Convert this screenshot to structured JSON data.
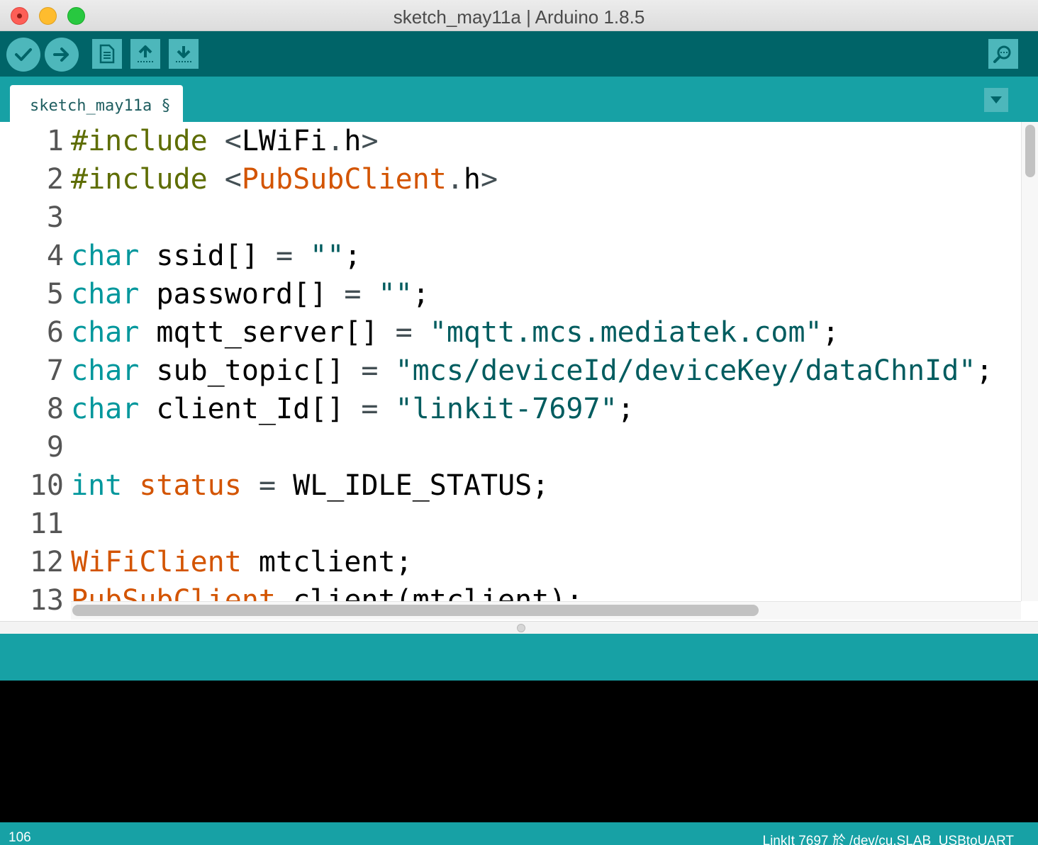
{
  "window": {
    "title": "sketch_may11a | Arduino 1.8.5"
  },
  "toolbar": {
    "verify": "check-icon",
    "upload": "arrow-right-icon",
    "new": "new-file-icon",
    "open": "arrow-up-icon",
    "save": "arrow-down-icon",
    "serial_monitor": "magnifier-icon"
  },
  "tabs": [
    {
      "label": "sketch_may11a §"
    }
  ],
  "editor": {
    "line_numbers": [
      "1",
      "2",
      "3",
      "4",
      "5",
      "6",
      "7",
      "8",
      "9",
      "10",
      "11",
      "12",
      "13"
    ],
    "lines": [
      [
        {
          "t": "#include",
          "c": "kw-pre"
        },
        {
          "t": " "
        },
        {
          "t": "<",
          "c": "kw-op"
        },
        {
          "t": "LWiFi"
        },
        {
          "t": ".",
          "c": "kw-op"
        },
        {
          "t": "h"
        },
        {
          "t": ">",
          "c": "kw-op"
        }
      ],
      [
        {
          "t": "#include",
          "c": "kw-pre"
        },
        {
          "t": " "
        },
        {
          "t": "<",
          "c": "kw-op"
        },
        {
          "t": "PubSubClient",
          "c": "kw-lib"
        },
        {
          "t": ".",
          "c": "kw-op"
        },
        {
          "t": "h"
        },
        {
          "t": ">",
          "c": "kw-op"
        }
      ],
      [],
      [
        {
          "t": "char",
          "c": "kw-type"
        },
        {
          "t": " ssid[] "
        },
        {
          "t": "=",
          "c": "kw-op"
        },
        {
          "t": " "
        },
        {
          "t": "\"\"",
          "c": "kw-str"
        },
        {
          "t": ";"
        }
      ],
      [
        {
          "t": "char",
          "c": "kw-type"
        },
        {
          "t": " password[] "
        },
        {
          "t": "=",
          "c": "kw-op"
        },
        {
          "t": " "
        },
        {
          "t": "\"\"",
          "c": "kw-str"
        },
        {
          "t": ";"
        }
      ],
      [
        {
          "t": "char",
          "c": "kw-type"
        },
        {
          "t": " mqtt_server[] "
        },
        {
          "t": "=",
          "c": "kw-op"
        },
        {
          "t": " "
        },
        {
          "t": "\"mqtt.mcs.mediatek.com\"",
          "c": "kw-str"
        },
        {
          "t": ";"
        }
      ],
      [
        {
          "t": "char",
          "c": "kw-type"
        },
        {
          "t": " sub_topic[] "
        },
        {
          "t": "=",
          "c": "kw-op"
        },
        {
          "t": " "
        },
        {
          "t": "\"mcs/deviceId/deviceKey/dataChnId\"",
          "c": "kw-str"
        },
        {
          "t": ";"
        }
      ],
      [
        {
          "t": "char",
          "c": "kw-type"
        },
        {
          "t": " client_Id[] "
        },
        {
          "t": "=",
          "c": "kw-op"
        },
        {
          "t": " "
        },
        {
          "t": "\"linkit-7697\"",
          "c": "kw-str"
        },
        {
          "t": ";"
        }
      ],
      [],
      [
        {
          "t": "int",
          "c": "kw-type"
        },
        {
          "t": " "
        },
        {
          "t": "status",
          "c": "kw-lib"
        },
        {
          "t": " "
        },
        {
          "t": "=",
          "c": "kw-op"
        },
        {
          "t": " WL_IDLE_STATUS;"
        }
      ],
      [],
      [
        {
          "t": "WiFiClient",
          "c": "kw-lib"
        },
        {
          "t": " mtclient;"
        }
      ],
      [
        {
          "t": "PubSubClient",
          "c": "kw-lib"
        },
        {
          "t": " client(mtclient);"
        }
      ]
    ]
  },
  "status": {
    "line": "106",
    "board": "LinkIt 7697 於 /dev/cu.SLAB_USBtoUART"
  }
}
